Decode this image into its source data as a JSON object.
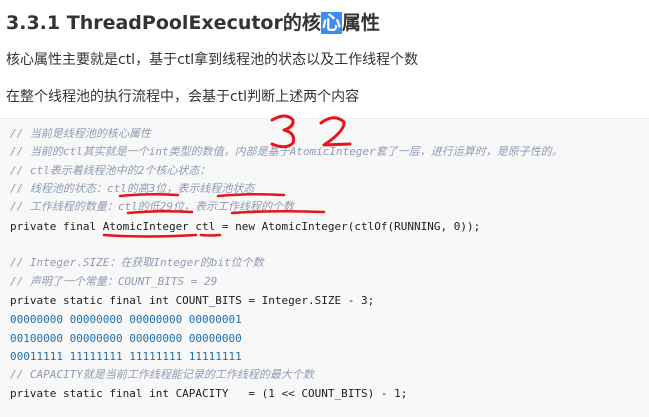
{
  "heading": {
    "number": "3.3.1",
    "title_before": "ThreadPoolExecutor的核",
    "title_highlight": "心",
    "title_after": "属性"
  },
  "paragraphs": [
    "核心属性主要就是ctl，基于ctl拿到线程池的状态以及工作线程个数",
    "在整个线程池的执行流程中，会基于ctl判断上述两个内容"
  ],
  "code": {
    "lines": [
      {
        "type": "comment",
        "text": "// 当前是线程池的核心属性"
      },
      {
        "type": "comment",
        "text": "// 当前的ctl其实就是一个int类型的数值，内部是基于AtomicInteger套了一层，进行运算时，是原子性的。"
      },
      {
        "type": "comment",
        "text": "// ctl表示着线程池中的2个核心状态："
      },
      {
        "type": "comment",
        "text": "// 线程池的状态：ctl的高3位，表示线程池状态"
      },
      {
        "type": "comment",
        "text": "// 工作线程的数量：ctl的低29位，表示工作线程的个数"
      },
      {
        "type": "code",
        "text": "private final AtomicInteger ctl = new AtomicInteger(ctlOf(RUNNING, 0));"
      },
      {
        "type": "blank",
        "text": ""
      },
      {
        "type": "comment",
        "text": "// Integer.SIZE：在获取Integer的bit位个数"
      },
      {
        "type": "comment",
        "text": "// 声明了一个常量：COUNT_BITS = 29"
      },
      {
        "type": "code",
        "text": "private static final int COUNT_BITS = Integer.SIZE - 3;"
      },
      {
        "type": "binary",
        "text": "00000000 00000000 00000000 00000001"
      },
      {
        "type": "binary",
        "text": "00100000 00000000 00000000 00000000"
      },
      {
        "type": "binary",
        "text": "00011111 11111111 11111111 11111111"
      },
      {
        "type": "comment",
        "text": "// CAPACITY就是当前工作线程能记录的工作线程的最大个数"
      },
      {
        "type": "code",
        "text": "private static final int CAPACITY   = (1 << COUNT_BITS) - 1;"
      }
    ]
  },
  "annotations": {
    "handwritten": "3 2",
    "ink_color": "#e8141b"
  }
}
